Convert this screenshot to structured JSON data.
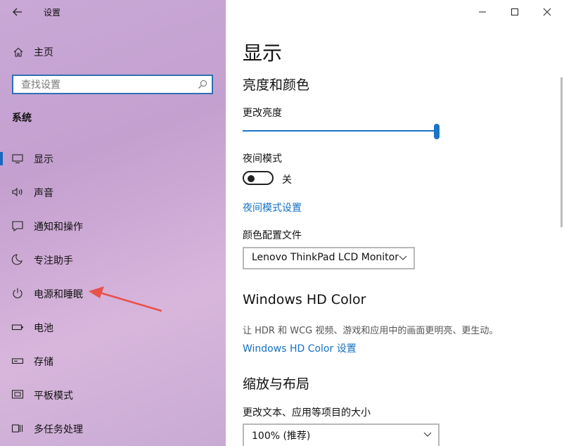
{
  "window": {
    "title": "设置",
    "controls": [
      "minimize-icon",
      "maximize-icon",
      "close-icon"
    ]
  },
  "sidebar": {
    "home_label": "主页",
    "search": {
      "placeholder": "查找设置",
      "value": ""
    },
    "section_title": "系统",
    "items": [
      {
        "label": "显示",
        "icon": "display-icon",
        "active": true
      },
      {
        "label": "声音",
        "icon": "speaker-icon",
        "active": false
      },
      {
        "label": "通知和操作",
        "icon": "notification-icon",
        "active": false
      },
      {
        "label": "专注助手",
        "icon": "moon-icon",
        "active": false
      },
      {
        "label": "电源和睡眠",
        "icon": "power-icon",
        "active": false
      },
      {
        "label": "电池",
        "icon": "battery-icon",
        "active": false
      },
      {
        "label": "存储",
        "icon": "storage-icon",
        "active": false
      },
      {
        "label": "平板模式",
        "icon": "tablet-icon",
        "active": false
      },
      {
        "label": "多任务处理",
        "icon": "multitask-icon",
        "active": false
      }
    ]
  },
  "annotation": {
    "arrow_color": "#e8524a"
  },
  "main": {
    "page_title": "显示",
    "brightness_section": "亮度和颜色",
    "brightness_label": "更改亮度",
    "brightness_value": 1.0,
    "night_mode_label": "夜间模式",
    "night_mode_state": "关",
    "night_mode_settings_link": "夜间模式设置",
    "color_profile_label": "颜色配置文件",
    "color_profile_value": "Lenovo ThinkPad LCD Monitor",
    "hd_color_title": "Windows HD Color",
    "hd_color_desc": "让 HDR 和 WCG 视频、游戏和应用中的画面更明亮、更生动。",
    "hd_color_link": "Windows HD Color 设置",
    "scale_section": "缩放与布局",
    "scale_label": "更改文本、应用等项目的大小",
    "scale_value": "100% (推荐)"
  },
  "colors": {
    "accent": "#1a74c7",
    "link": "#1570c2"
  }
}
